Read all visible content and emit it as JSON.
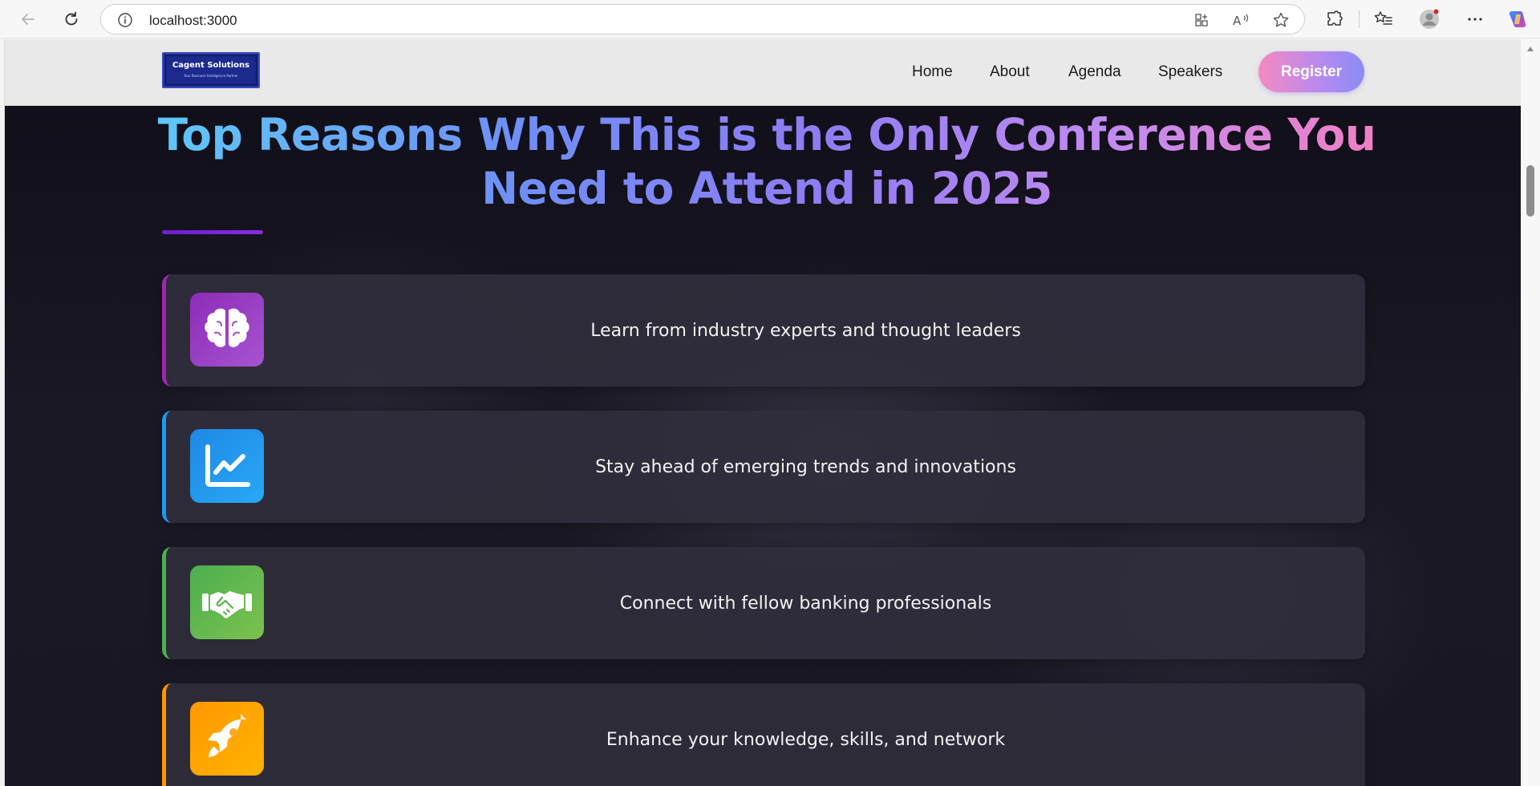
{
  "browser": {
    "url": "localhost:3000"
  },
  "site": {
    "logo": {
      "title": "Cagent Solutions",
      "subtitle": "Your Business Intelligence Partner"
    },
    "nav": [
      {
        "label": "Home"
      },
      {
        "label": "About"
      },
      {
        "label": "Agenda"
      },
      {
        "label": "Speakers"
      }
    ],
    "register_label": "Register"
  },
  "main": {
    "heading_line1": "Top Reasons Why This is the Only Conference You",
    "heading_line2": "Need to Attend in 2025",
    "reasons": [
      {
        "text": "Learn from industry experts and thought leaders",
        "icon": "brain-icon",
        "color": "#9b3fc7"
      },
      {
        "text": "Stay ahead of emerging trends and innovations",
        "icon": "trend-chart-icon",
        "color": "#2196f3"
      },
      {
        "text": "Connect with fellow banking professionals",
        "icon": "handshake-icon",
        "color": "#5cb85c"
      },
      {
        "text": "Enhance your knowledge, skills, and network",
        "icon": "rocket-icon",
        "color": "#ffa500"
      }
    ]
  },
  "colors": {
    "heading_gradient": [
      "#5fc8f7",
      "#6f8ef6",
      "#8f7cf2",
      "#c28bf0",
      "#f27fc5"
    ],
    "register_gradient": [
      "#f58ac0",
      "#b58af0",
      "#8a8cf5"
    ],
    "card_bg": "#302e3c"
  }
}
